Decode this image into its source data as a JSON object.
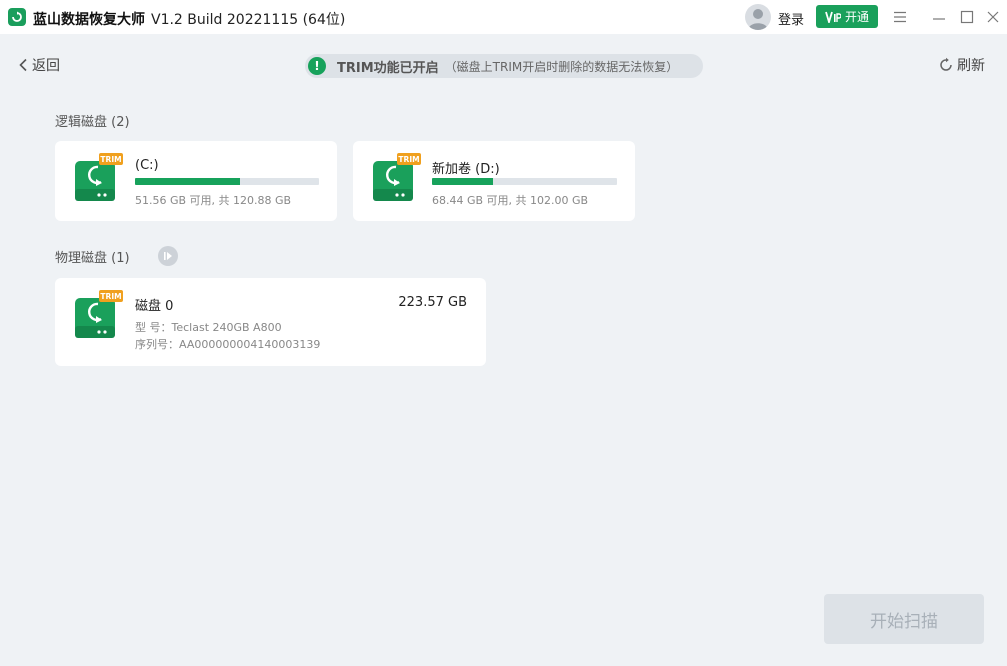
{
  "app": {
    "name": "蓝山数据恢复大师",
    "version": "V1.2 Build 20221115 (64位)",
    "login_label": "登录",
    "vip_label": "开通",
    "vip_badge": "VIP",
    "accent_color": "#17a25b"
  },
  "window_controls": {
    "menu_icon": "menu-icon",
    "minimize_icon": "minimize-icon",
    "maximize_icon": "maximize-icon",
    "close_icon": "close-icon"
  },
  "header": {
    "back_label": "返回",
    "trim_title": "TRIM功能已开启",
    "trim_desc": "（磁盘上TRIM开启时删除的数据无法恢复）",
    "refresh_label": "刷新"
  },
  "logical": {
    "label": "逻辑磁盘 (2)",
    "drives": [
      {
        "badge": "TRIM",
        "name": "(C:)",
        "used_fraction": 0.573,
        "usage": "51.56 GB 可用, 共 120.88 GB"
      },
      {
        "badge": "TRIM",
        "name": "新加卷 (D:)",
        "used_fraction": 0.329,
        "usage": "68.44 GB 可用, 共 102.00 GB"
      }
    ]
  },
  "physical": {
    "label": "物理磁盘 (1)",
    "disks": [
      {
        "badge": "TRIM",
        "name": "磁盘 0",
        "size": "223.57 GB",
        "model": "型    号：Teclast 240GB A800",
        "serial": "序列号：AA000000004140003139"
      }
    ]
  },
  "scan_label": "开始扫描"
}
